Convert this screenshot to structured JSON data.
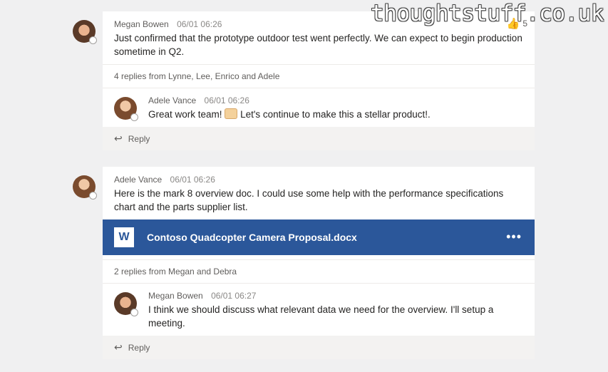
{
  "watermark": "thoughtstuff.co.uk",
  "threads": [
    {
      "author": "Megan Bowen",
      "time": "06/01 06:26",
      "message": "Just confirmed that the prototype outdoor test went perfectly. We can expect to begin production sometime in Q2.",
      "like_count": "5",
      "replies_summary": "4 replies from Lynne, Lee, Enrico and Adele",
      "reply": {
        "author": "Adele Vance",
        "time": "06/01 06:26",
        "message_before": "Great work team!",
        "message_after": "Let's continue to make this a stellar product!."
      },
      "reply_label": "Reply"
    },
    {
      "author": "Adele Vance",
      "time": "06/01 06:26",
      "message": "Here is the mark 8 overview doc. I could use some help with the performance specifications chart and the parts supplier list.",
      "attachment": {
        "name": "Contoso Quadcopter Camera Proposal.docx",
        "icon_letter": "W"
      },
      "replies_summary": "2 replies from Megan and Debra",
      "reply": {
        "author": "Megan Bowen",
        "time": "06/01 06:27",
        "message": "I think we should discuss what relevant data we need for the overview. I'll setup a meeting."
      },
      "reply_label": "Reply"
    }
  ]
}
